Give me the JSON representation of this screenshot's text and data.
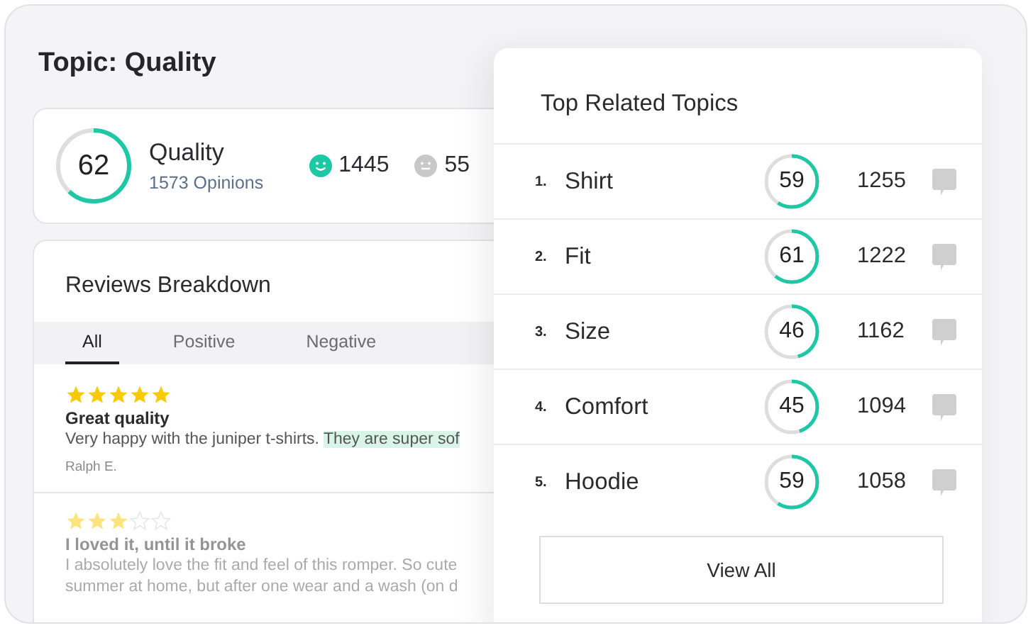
{
  "page_title": "Topic: Quality",
  "summary": {
    "score": "62",
    "level": 0.62,
    "name": "Quality",
    "opinions": "1573 Opinions",
    "positive_count": "1445",
    "neutral_count": "55"
  },
  "reviews_card": {
    "title": "Reviews Breakdown",
    "tabs": [
      {
        "label": "All",
        "selected": true
      },
      {
        "label": "Positive",
        "selected": false
      },
      {
        "label": "Negative",
        "selected": false
      }
    ],
    "reviews": [
      {
        "stars": 5,
        "title": "Great quality",
        "lines": [
          {
            "text": "Very happy with the juniper t-shirts. ",
            "highlight": "They are super sof"
          }
        ],
        "author": "Ralph E.",
        "faded": false
      },
      {
        "stars": 3,
        "title": "I loved it, until it broke",
        "lines": [
          {
            "text": "I absolutely love the fit and feel of this romper. So cute"
          },
          {
            "text": "summer at home, but after one wear and a wash (on d"
          }
        ],
        "faded": true
      }
    ]
  },
  "related_panel": {
    "title": "Top Related Topics",
    "topics": [
      {
        "rank": "1.",
        "name": "Shirt",
        "score": "59",
        "level": 0.59,
        "count": "1255"
      },
      {
        "rank": "2.",
        "name": "Fit",
        "score": "61",
        "level": 0.61,
        "count": "1222"
      },
      {
        "rank": "3.",
        "name": "Size",
        "score": "46",
        "level": 0.46,
        "count": "1162"
      },
      {
        "rank": "4.",
        "name": "Comfort",
        "score": "45",
        "level": 0.45,
        "count": "1094"
      },
      {
        "rank": "5.",
        "name": "Hoodie",
        "score": "59",
        "level": 0.59,
        "count": "1058"
      }
    ],
    "button": "View All"
  }
}
